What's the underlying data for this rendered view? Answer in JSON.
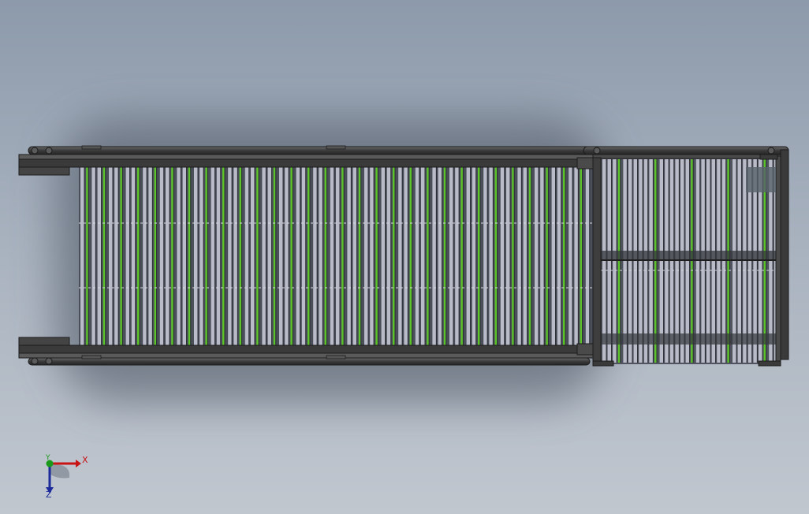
{
  "viewport": {
    "background_top": "#8d9aab",
    "background_bottom": "#c1c7cf"
  },
  "model": {
    "frame_color": "#3c3c3c",
    "slat_color": "#b9bcc8",
    "accent_color": "#5cc42a"
  },
  "triad": {
    "x_label": "X",
    "y_label": "Y",
    "z_label": "Z",
    "x_color": "#c81414",
    "y_color": "#1a9a1a",
    "z_color": "#1c2a9c"
  }
}
